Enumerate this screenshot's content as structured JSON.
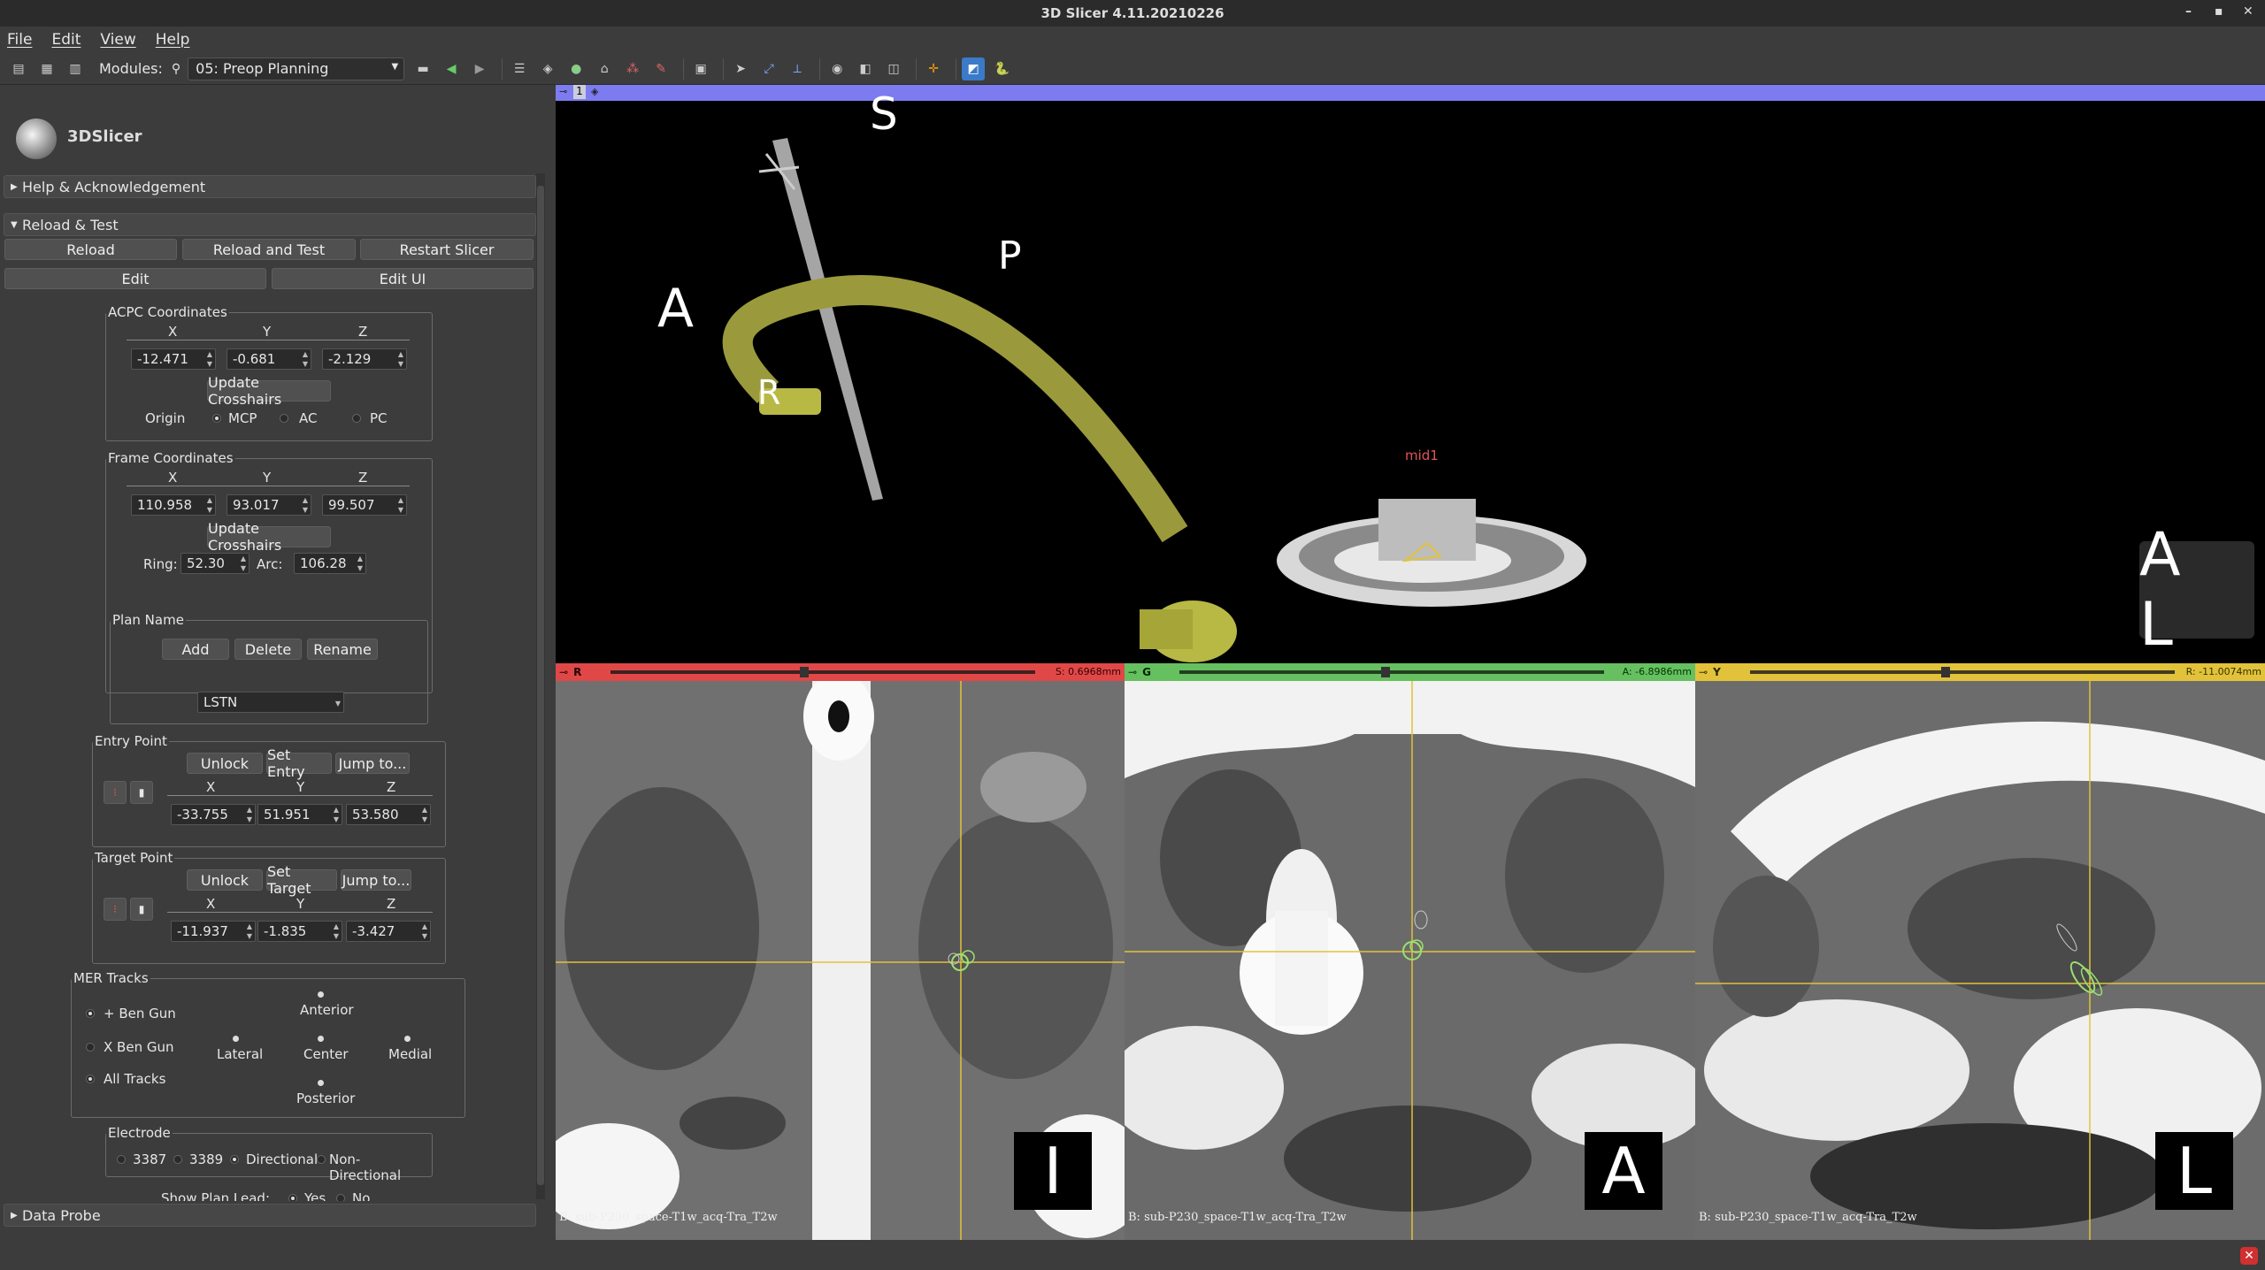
{
  "window": {
    "title": "3D Slicer 4.11.20210226"
  },
  "menu": [
    "File",
    "Edit",
    "View",
    "Help"
  ],
  "toolbar": {
    "modules_label": "Modules:",
    "module_selected": "05: Preop Planning"
  },
  "logo_text": "3DSlicer",
  "sections": {
    "help": "Help & Acknowledgement",
    "reload": "Reload & Test",
    "data_probe": "Data Probe"
  },
  "reload_buttons": {
    "reload": "Reload",
    "reload_test": "Reload and Test",
    "restart": "Restart Slicer",
    "edit": "Edit",
    "edit_ui": "Edit UI"
  },
  "acpc": {
    "title": "ACPC Coordinates",
    "headers": [
      "X",
      "Y",
      "Z"
    ],
    "values": [
      "-12.471",
      "-0.681",
      "-2.129"
    ],
    "update": "Update Crosshairs",
    "origin_label": "Origin",
    "origins": [
      "MCP",
      "AC",
      "PC"
    ]
  },
  "frame": {
    "title": "Frame Coordinates",
    "headers": [
      "X",
      "Y",
      "Z"
    ],
    "values": [
      "110.958",
      "93.017",
      "99.507"
    ],
    "update": "Update Crosshairs",
    "ring_label": "Ring:",
    "ring": "52.30",
    "arc_label": "Arc:",
    "arc": "106.28"
  },
  "plan": {
    "title": "Plan Name",
    "add": "Add",
    "delete": "Delete",
    "rename": "Rename",
    "selected": "LSTN"
  },
  "entry": {
    "title": "Entry Point",
    "unlock": "Unlock",
    "set": "Set Entry",
    "jump": "Jump to...",
    "headers": [
      "X",
      "Y",
      "Z"
    ],
    "values": [
      "-33.755",
      "51.951",
      "53.580"
    ]
  },
  "target": {
    "title": "Target Point",
    "unlock": "Unlock",
    "set": "Set Target",
    "jump": "Jump to...",
    "headers": [
      "X",
      "Y",
      "Z"
    ],
    "values": [
      "-11.937",
      "-1.835",
      "-3.427"
    ]
  },
  "mer": {
    "title": "MER Tracks",
    "options": [
      "+ Ben Gun",
      "X Ben Gun",
      "All Tracks"
    ],
    "tracks": {
      "anterior": "Anterior",
      "lateral": "Lateral",
      "center": "Center",
      "medial": "Medial",
      "posterior": "Posterior"
    }
  },
  "electrode": {
    "title": "Electrode",
    "options": [
      "3387",
      "3389",
      "Directional",
      "Non-Directional"
    ]
  },
  "show_plan_lead": {
    "label": "Show Plan Lead:",
    "yes": "Yes",
    "no": "No"
  },
  "view3d": {
    "layout_number": "1",
    "orientation": {
      "S": "S",
      "A": "A",
      "P": "P",
      "R": "R"
    },
    "marker_label": "mid1",
    "cube_labels": "A L"
  },
  "slices": [
    {
      "letter": "R",
      "offset": "S: 0.6968mm",
      "color": "#e04848",
      "orient": "I",
      "volume": "B: sub-P230_space-T1w_acq-Tra_T2w"
    },
    {
      "letter": "G",
      "offset": "A: -6.8986mm",
      "color": "#66c060",
      "orient": "A",
      "volume": "B: sub-P230_space-T1w_acq-Tra_T2w"
    },
    {
      "letter": "Y",
      "offset": "R: -11.0074mm",
      "color": "#e2c23a",
      "orient": "L",
      "volume": "B: sub-P230_space-T1w_acq-Tra_T2w"
    }
  ],
  "colors": {
    "view3d_bar": "#7c7cf0",
    "red_slice": "#e04848",
    "green_slice": "#66c060",
    "yellow_slice": "#e2c23a",
    "frame_arc": "#9a9a3c"
  }
}
